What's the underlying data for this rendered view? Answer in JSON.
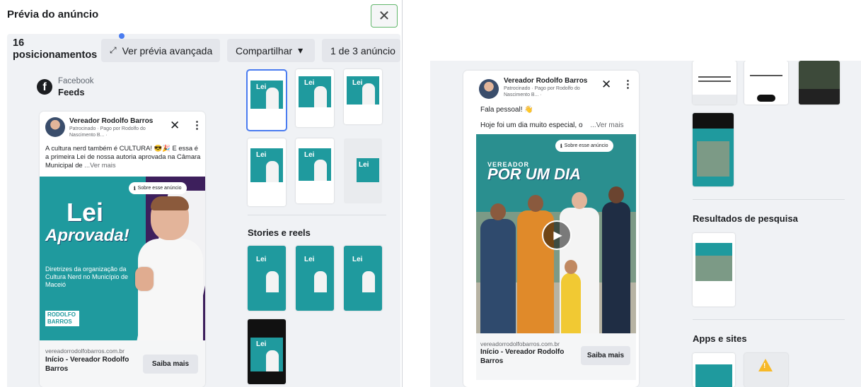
{
  "dialog": {
    "title": "Prévia do anúncio",
    "close_label": "✕"
  },
  "toolbar": {
    "placements_count": "16",
    "placements_label": "posicionamentos",
    "advanced_preview_label": "Ver prévia avançada",
    "advanced_preview_icon": "expand-icon",
    "share_label": "Compartilhar",
    "share_caret": "▾",
    "ad_counter": "1 de 3 anúncio"
  },
  "placement": {
    "platform": "Facebook",
    "position": "Feeds"
  },
  "feed_ad": {
    "page_name": "Vereador Rodolfo Barros",
    "sponsor_line": "Patrocinado · Pago por Rodolfo do Nascimento B... · ",
    "close_icon": "✕",
    "more_icon": "⋮",
    "primary_text": "A cultura nerd também é CULTURA! 😎🎉 E essa é a primeira Lei de nossa autoria aprovada na Câmara Municipal de",
    "see_more": "...Ver mais",
    "about_ad": "Sobre esse anúncio",
    "creative_headline_1": "Lei",
    "creative_headline_2": "Aprovada!",
    "creative_body": "Diretrizes da organização da Cultura Nerd no Município de Maceió",
    "creative_logo": "RODOLFO BARROS",
    "link_url": "vereadorrodolfobarros.com.br",
    "link_title": "Início - Vereador Rodolfo Barros",
    "cta_label": "Saiba mais"
  },
  "sections": {
    "stories_reels": "Stories e reels",
    "search_results": "Resultados de pesquisa",
    "apps_sites": "Apps e sites"
  },
  "thumbnails": {
    "lei_label": "Lei"
  },
  "video_ad": {
    "page_name": "Vereador Rodolfo Barros",
    "sponsor_line": "Patrocinado · Pago por Rodolfo do Nascimento B... · ",
    "close_icon": "✕",
    "more_icon": "⋮",
    "greeting": "Fala pessoal! 👋",
    "primary_text": "Hoje foi um dia muito especial, o",
    "see_more": "...Ver mais",
    "about_ad": "Sobre esse anúncio",
    "video_tag": "VEREADOR",
    "video_headline": "POR UM DIA",
    "play_icon": "▶",
    "link_url": "vereadorrodolfobarros.com.br",
    "link_title": "Início - Vereador Rodolfo Barros",
    "cta_label": "Saiba mais"
  },
  "colors": {
    "accent_blue": "#4a7cf0",
    "teal": "#1f9a9e",
    "purple": "#3d1f5c",
    "warning": "#f7b928"
  }
}
